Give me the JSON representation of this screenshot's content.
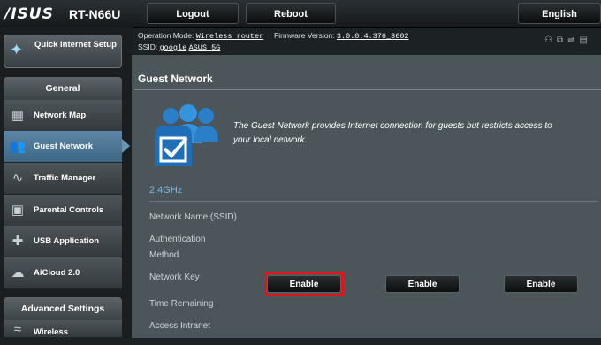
{
  "header": {
    "brand": "/ISUS",
    "model": "RT-N66U",
    "logout_label": "Logout",
    "reboot_label": "Reboot",
    "language_label": "English"
  },
  "info": {
    "operation_mode_label": "Operation Mode:",
    "operation_mode_value": "Wireless router",
    "firmware_label": "Firmware Version:",
    "firmware_value": "3.0.0.4.376_3602",
    "ssid_label": "SSID:",
    "ssid_1": "google",
    "ssid_2": "ASUS_5G"
  },
  "sidebar": {
    "quick_setup_label": "Quick Internet Setup",
    "general_header": "General",
    "items": [
      {
        "label": "Network Map",
        "icon": "network-map-icon"
      },
      {
        "label": "Guest Network",
        "icon": "guest-network-icon"
      },
      {
        "label": "Traffic Manager",
        "icon": "traffic-manager-icon"
      },
      {
        "label": "Parental Controls",
        "icon": "parental-controls-icon"
      },
      {
        "label": "USB Application",
        "icon": "usb-application-icon"
      },
      {
        "label": "AiCloud 2.0",
        "icon": "aicloud-icon"
      }
    ],
    "advanced_header": "Advanced Settings",
    "advanced_items": [
      {
        "label": "Wireless",
        "icon": "wireless-icon"
      }
    ]
  },
  "main": {
    "title": "Guest Network",
    "description": "The Guest Network provides Internet connection for guests but restricts access to your local network.",
    "band": "2.4GHz",
    "fields": [
      "Network Name (SSID)",
      "Authentication Method",
      "Network Key",
      "Time Remaining",
      "Access Intranet"
    ],
    "enable_buttons": [
      "Enable",
      "Enable",
      "Enable"
    ]
  },
  "colors": {
    "accent": "#7fb6e5",
    "highlight": "#e4141b",
    "active_menu": "#4f7897"
  }
}
